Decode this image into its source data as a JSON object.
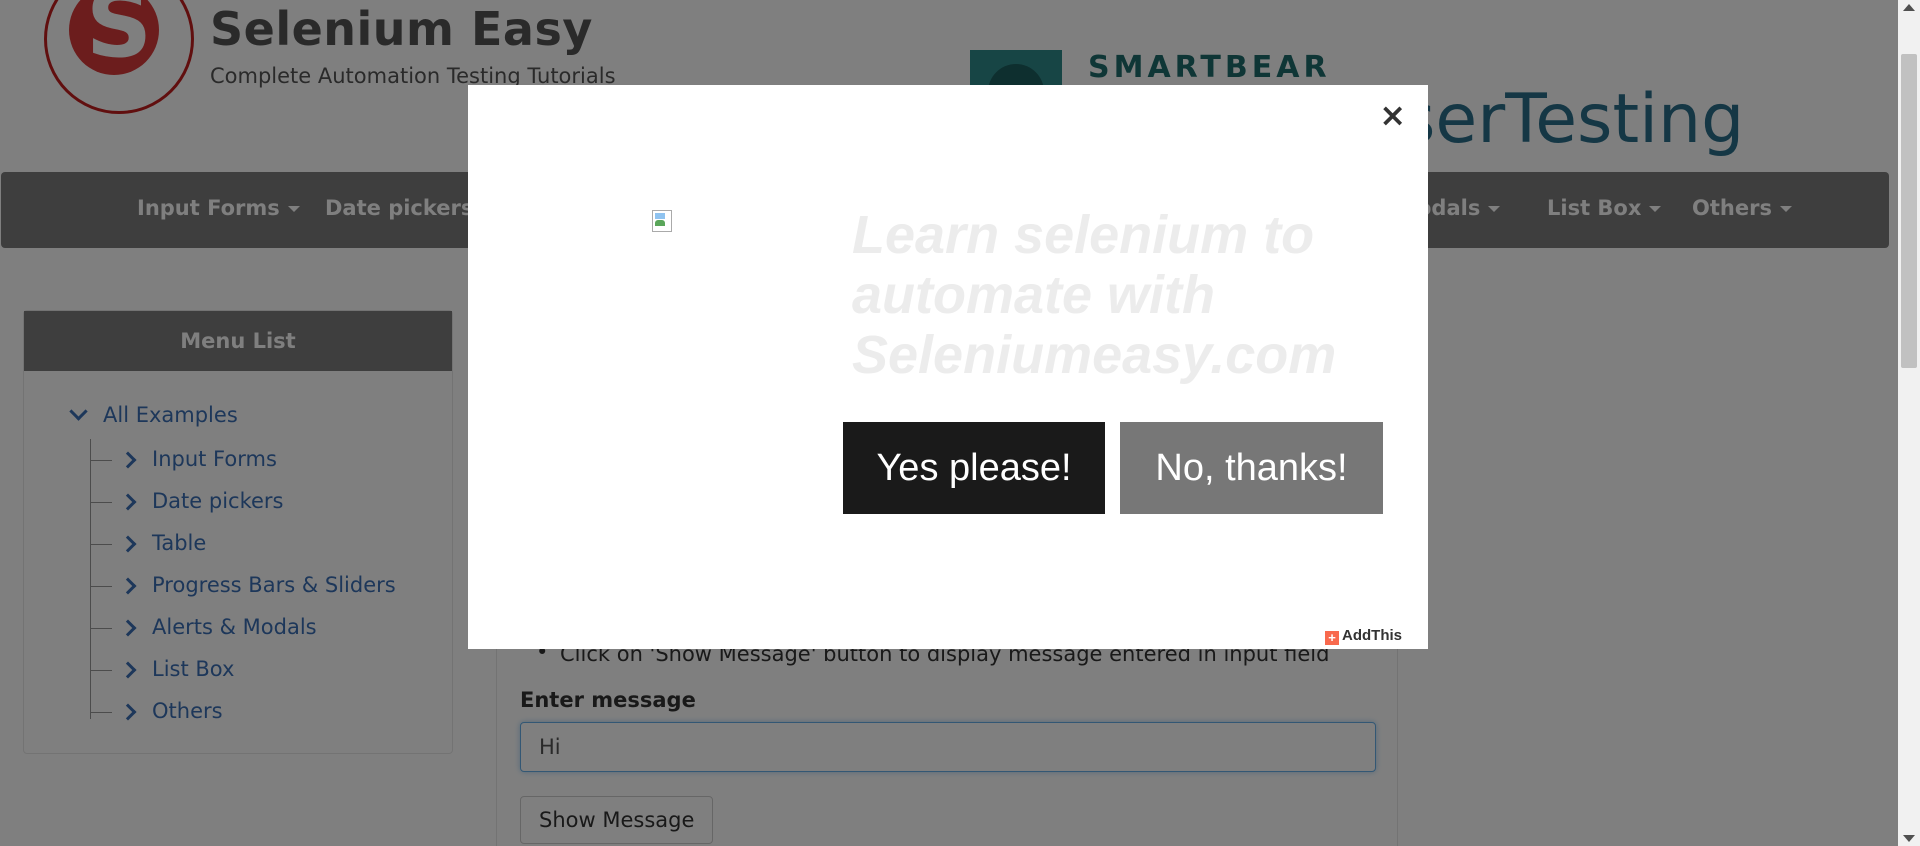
{
  "header": {
    "logo_letter": "S",
    "title": "Selenium Easy",
    "subtitle": "Complete Automation Testing Tutorials"
  },
  "ad": {
    "brand": "SMARTBEAR",
    "product_partial": "serTesting"
  },
  "nav": {
    "items": [
      {
        "label": "Input Forms"
      },
      {
        "label": "Date pickers"
      },
      {
        "label": "odals"
      },
      {
        "label": "List Box"
      },
      {
        "label": "Others"
      }
    ]
  },
  "sidebar": {
    "heading": "Menu List",
    "root": "All Examples",
    "items": [
      {
        "label": "Input Forms"
      },
      {
        "label": "Date pickers"
      },
      {
        "label": "Table"
      },
      {
        "label": "Progress Bars & Sliders"
      },
      {
        "label": "Alerts & Modals"
      },
      {
        "label": "List Box"
      },
      {
        "label": "Others"
      }
    ]
  },
  "main": {
    "bullet": "Click on 'Show Message' button to display message entered in input field",
    "input_label": "Enter message",
    "input_value": "Hi",
    "show_button": "Show Message"
  },
  "modal": {
    "close": "×",
    "headline": "Learn selenium to automate with Seleniumeasy.com",
    "yes_button": "Yes please!",
    "no_button": "No, thanks!",
    "addthis": "AddThis"
  },
  "colors": {
    "overlay": "#000000",
    "nav_bg": "#7c7c7c",
    "link": "#3b6fb5",
    "yes_bg": "#1a1a1a",
    "no_bg": "#777777"
  }
}
